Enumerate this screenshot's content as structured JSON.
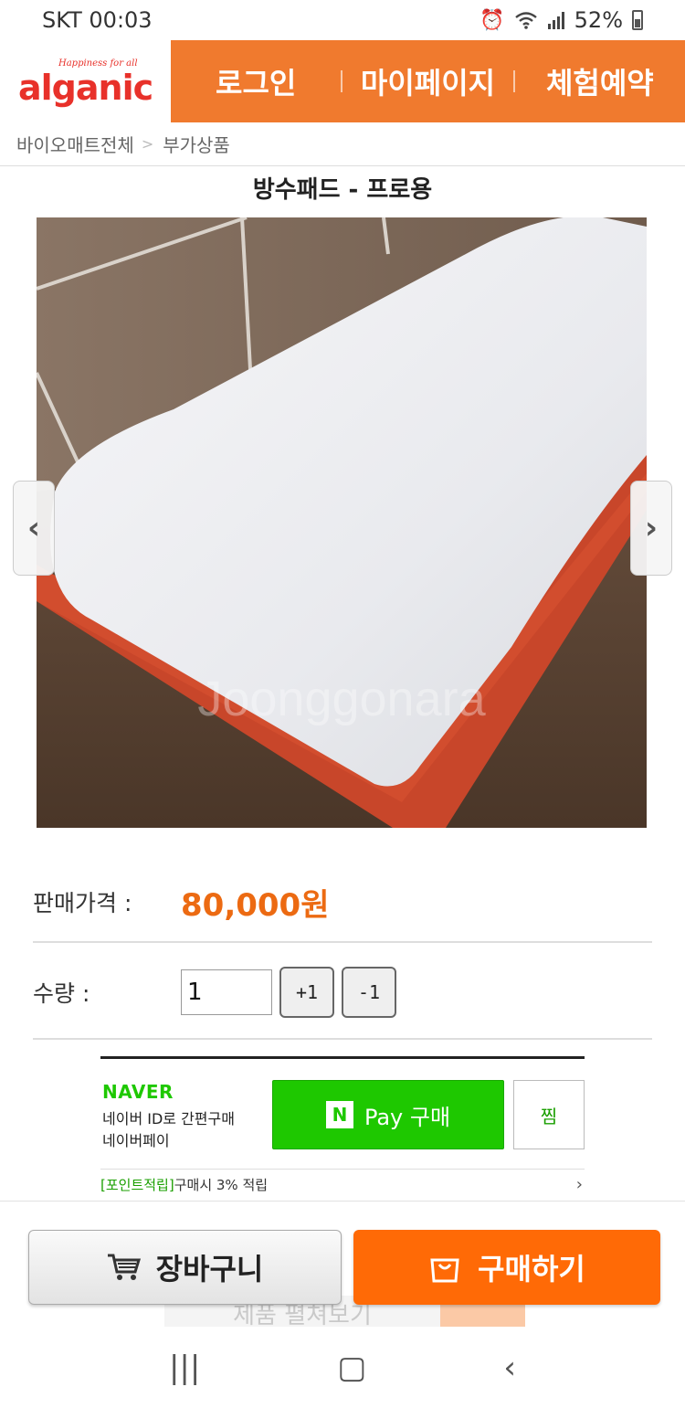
{
  "status_bar": {
    "carrier_time": "SKT 00:03",
    "battery": "52%",
    "icons": [
      "alarm-icon",
      "wifi-icon",
      "signal-icon",
      "battery-icon"
    ]
  },
  "header": {
    "logo_tagline": "Happiness for all",
    "logo_text": "alganic",
    "nav": [
      "로그인",
      "마이페이지",
      "체험예약"
    ]
  },
  "breadcrumb": [
    "바이오매트전체",
    "부가상품"
  ],
  "product": {
    "title": "방수패드 - 프로용",
    "image_alt": "mattress-pad-photo"
  },
  "price": {
    "label": "판매가격 :",
    "value": "80,000원"
  },
  "quantity": {
    "label": "수량 :",
    "value": "1",
    "plus": "+1",
    "minus": "-1"
  },
  "naver_pay": {
    "logo": "NAVER",
    "desc_line1": "네이버 ID로 간편구매",
    "desc_line2": "네이버페이",
    "n_mark": "N",
    "button": "Pay 구매",
    "zzim": "찜",
    "point_tag": "[포인트적립]",
    "point_text": "구매시 3% 적립"
  },
  "bottom": {
    "cart": "장바구니",
    "buy": "구매하기",
    "behind_text": "제품 펼쳐보기"
  },
  "colors": {
    "brand_orange": "#f07a2e",
    "buy_orange": "#ff6a06",
    "price_orange": "#ec6a12",
    "naver_green": "#1ec800",
    "logo_red": "#e8312a"
  }
}
